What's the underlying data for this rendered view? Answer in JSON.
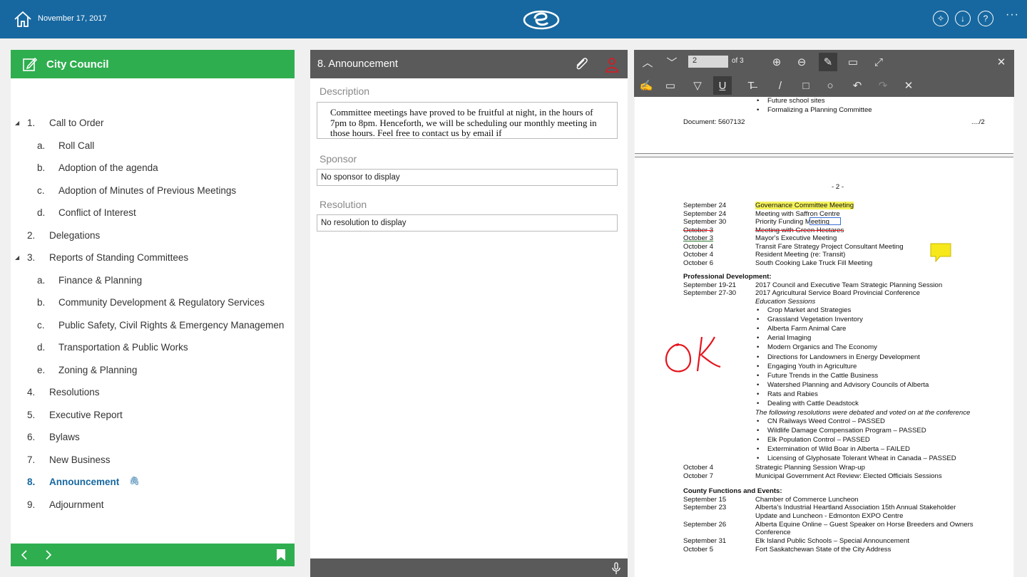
{
  "topbar": {
    "date": "November 17, 2017",
    "icons": [
      "home-icon",
      "logo-icon",
      "pin-icon",
      "download-icon",
      "help-icon",
      "more-icon"
    ],
    "more": "···",
    "help": "?"
  },
  "agenda": {
    "title": "City Council",
    "items": [
      {
        "num": "1.",
        "label": "Call to Order",
        "level": 0,
        "expanded": true
      },
      {
        "num": "a.",
        "label": "Roll Call",
        "level": 1
      },
      {
        "num": "b.",
        "label": "Adoption of the agenda",
        "level": 1
      },
      {
        "num": "c.",
        "label": "Adoption of Minutes of Previous Meetings",
        "level": 1
      },
      {
        "num": "d.",
        "label": "Conflict of Interest",
        "level": 1
      },
      {
        "num": "2.",
        "label": "Delegations",
        "level": 0
      },
      {
        "num": "3.",
        "label": "Reports of Standing Committees",
        "level": 0,
        "expanded": true
      },
      {
        "num": "a.",
        "label": "Finance & Planning",
        "level": 1
      },
      {
        "num": "b.",
        "label": "Community Development & Regulatory Services",
        "level": 1
      },
      {
        "num": "c.",
        "label": "Public Safety, Civil Rights & Emergency Managemen",
        "level": 1
      },
      {
        "num": "d.",
        "label": "Transportation & Public Works",
        "level": 1
      },
      {
        "num": "e.",
        "label": "Zoning & Planning",
        "level": 1
      },
      {
        "num": "4.",
        "label": "Resolutions",
        "level": 0
      },
      {
        "num": "5.",
        "label": "Executive Report",
        "level": 0
      },
      {
        "num": "6.",
        "label": "Bylaws",
        "level": 0
      },
      {
        "num": "7.",
        "label": "New Business",
        "level": 0
      },
      {
        "num": "8.",
        "label": "Announcement",
        "level": 0,
        "active": true,
        "attachment": true
      },
      {
        "num": "9.",
        "label": "Adjournment",
        "level": 0
      }
    ]
  },
  "detail": {
    "title": "8.  Announcement",
    "description_label": "Description",
    "description": "Committee meetings have proved to be fruitful at night, in the hours of 7pm to 8pm. Henceforth, we will be scheduling our monthly meeting in those hours. Feel free to contact us by email if",
    "sponsor_label": "Sponsor",
    "sponsor": "No sponsor to display",
    "resolution_label": "Resolution",
    "resolution": "No resolution to display"
  },
  "viewer": {
    "page": "2",
    "page_of": "of 3",
    "doc": {
      "p1": [
        {
          "t": "Future school sites",
          "bullet": true
        },
        {
          "t": "Formalizing a Planning Committee",
          "bullet": true
        }
      ],
      "docnum": "Document: 5607132",
      "cont": "..../2",
      "pagenum": "- 2 -",
      "meetings": [
        [
          "September 24",
          "Governance Committee Meeting"
        ],
        [
          "September 24",
          "Meeting with Saffron Centre"
        ],
        [
          "September 30",
          "Priority Funding Meeting"
        ],
        [
          "October 3",
          "Meeting with Green Hectares"
        ],
        [
          "October 3",
          "Mayor's Executive Meeting"
        ],
        [
          "October 4",
          "Transit Fare Strategy Project Consultant Meeting"
        ],
        [
          "October 4",
          "Resident Meeting (re: Transit)"
        ],
        [
          "October 6",
          "South Cooking Lake Truck Fill Meeting"
        ]
      ],
      "prof_heading": "Professional Development:",
      "prof": [
        [
          "September 19-21",
          "2017 Council and Executive Team Strategic Planning Session"
        ],
        [
          "September 27-30",
          "2017 Agricultural Service Board Provincial Conference"
        ]
      ],
      "edu": "Education Sessions",
      "sessions": [
        "Crop Market and Strategies",
        "Grassland Vegetation Inventory",
        "Alberta Farm Animal Care",
        "Aerial Imaging",
        "Modern Organics and The Economy",
        "Directions for Landowners in Energy Development",
        "Engaging Youth in Agriculture",
        "Future Trends in the Cattle Business",
        "Watershed Planning and Advisory Councils of Alberta",
        "Rats and Rabies",
        "Dealing with Cattle Deadstock"
      ],
      "resolutions_note": "The following resolutions were debated and voted on at the conference",
      "resolutions": [
        "CN Railways Weed Control – PASSED",
        "Wildlife Damage Compensation Program – PASSED",
        "Elk Population Control – PASSED",
        "Extermination of Wild Boar in Alberta – FAILED",
        "Licensing of Glyphosate Tolerant Wheat in Canada – PASSED"
      ],
      "oct": [
        [
          "October 4",
          "Strategic Planning Session Wrap-up"
        ],
        [
          "October 7",
          "Municipal Government Act Review: Elected Officials Sessions"
        ]
      ],
      "county_heading": "County Functions and Events:",
      "county": [
        [
          "September 15",
          "Chamber of Commerce Luncheon"
        ],
        [
          "September 23",
          "Alberta's Industrial Heartland Association 15th Annual Stakeholder"
        ],
        [
          "",
          "Update and Luncheon  - Edmonton EXPO Centre"
        ],
        [
          "September 26",
          "Alberta Equine Online – Guest Speaker on Horse Breeders and Owners"
        ],
        [
          "",
          "Conference"
        ],
        [
          "September 31",
          "Elk Island Public Schools – Special Announcement"
        ],
        [
          "October 5",
          "Fort Saskatchewan State of the City Address"
        ]
      ],
      "annotation_color": "#e5141c",
      "highlight_color": "#f4f25a",
      "note_color": "#f6e81a"
    }
  },
  "colors": {
    "topbar": "#1768a0",
    "green": "#2fae4f",
    "gray": "#5a5a5a",
    "active": "#1768a0"
  }
}
